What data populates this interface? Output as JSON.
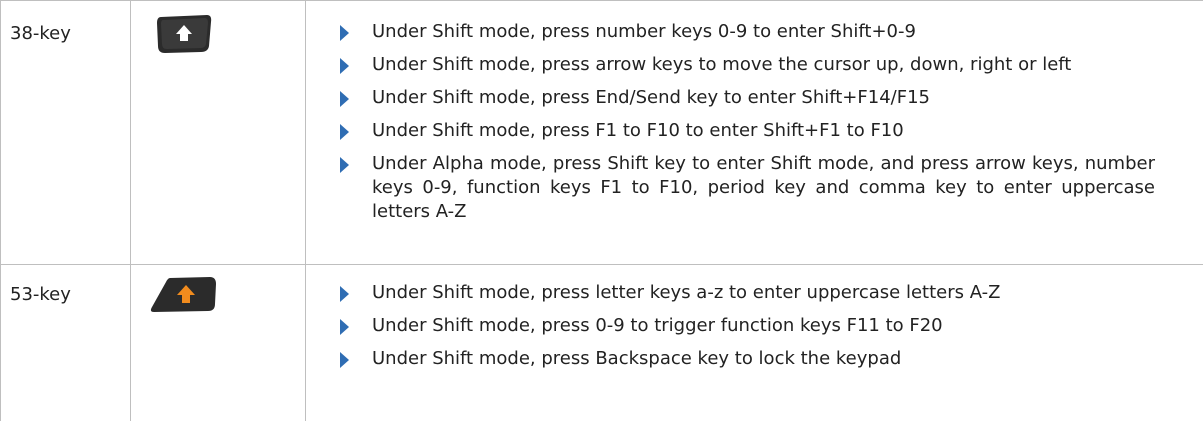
{
  "rows": [
    {
      "keypad": "38-key",
      "icon": "shift-key-black-icon",
      "bullets": [
        "Under Shift mode, press number keys 0-9 to enter Shift+0-9",
        "Under Shift mode, press arrow keys to move the cursor up, down, right or left",
        "Under Shift mode, press End/Send key to enter Shift+F14/F15",
        "Under Shift mode, press F1 to F10 to enter Shift+F1 to F10",
        "Under Alpha mode, press Shift key to enter Shift mode, and press arrow keys, number keys 0-9, function keys F1 to F10, period key and comma key to enter uppercase letters A-Z"
      ]
    },
    {
      "keypad": "53-key",
      "icon": "shift-key-orange-icon",
      "bullets": [
        "Under Shift mode, press letter keys a-z to enter uppercase letters A-Z",
        "Under Shift mode, press 0-9 to trigger function keys F11 to F20",
        "Under Shift mode, press Backspace key to lock the keypad"
      ]
    }
  ],
  "colors": {
    "bullet": "#2f6db3",
    "grid": "#bfbfbf",
    "key_dark": "#2b2b2b",
    "key_arrow_orange": "#f28c1e"
  }
}
